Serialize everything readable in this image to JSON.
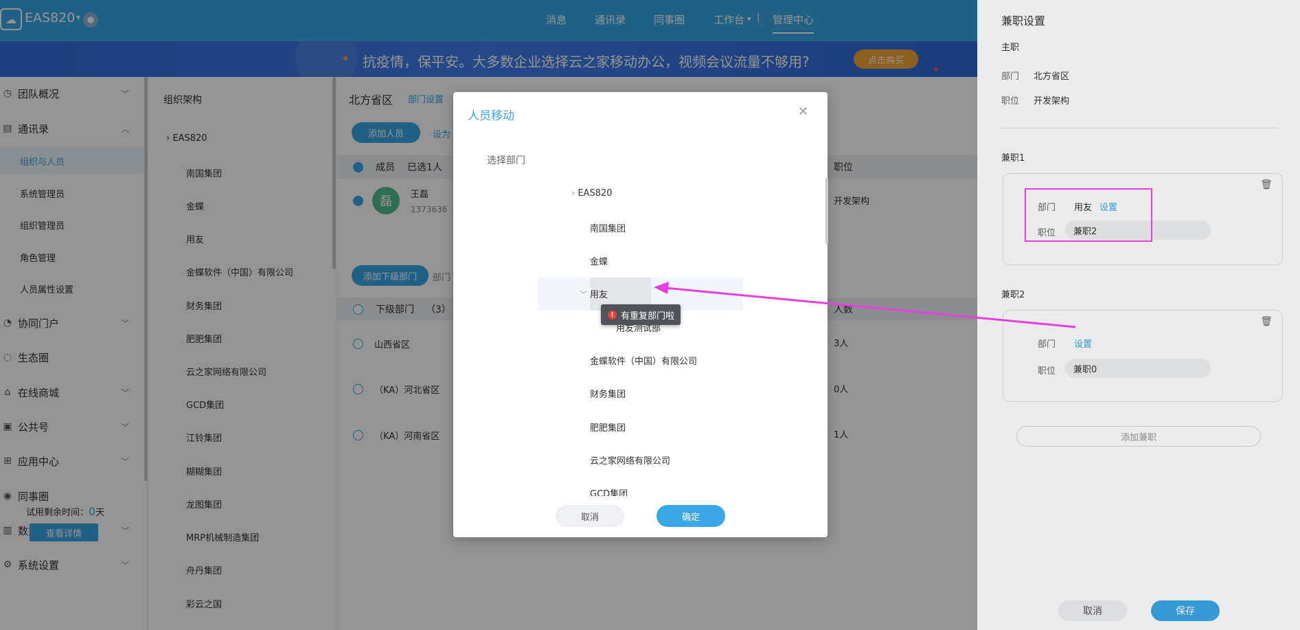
{
  "topbar": {
    "company": "EAS820",
    "nav": [
      "消息",
      "通讯录",
      "同事圈",
      "工作台",
      "管理中心"
    ]
  },
  "banner": {
    "text": "抗疫情，保平安。大多数企业选择云之家移动办公，视频会议流量不够用?",
    "button": "点击购买"
  },
  "sidebar": {
    "items": [
      {
        "label": "团队概况"
      },
      {
        "label": "通讯录"
      },
      {
        "label": "协同门户"
      },
      {
        "label": "生态圈"
      },
      {
        "label": "在线商城"
      },
      {
        "label": "公共号"
      },
      {
        "label": "应用中心"
      },
      {
        "label": "同事圈"
      },
      {
        "label": "数据运营"
      },
      {
        "label": "系统设置"
      }
    ],
    "sub_items": [
      "组织与人员",
      "系统管理员",
      "组织管理员",
      "角色管理",
      "人员属性设置"
    ],
    "trial_label": "试用剩余时间：",
    "trial_days": "0",
    "trial_unit": "天",
    "detail_button": "查看详情"
  },
  "org": {
    "title": "组织架构",
    "root": "EAS820",
    "items": [
      "南国集团",
      "金蝶",
      "用友",
      "金蝶软件（中国）有限公司",
      "财务集团",
      "肥肥集团",
      "云之家网络有限公司",
      "GCD集团",
      "江铃集团",
      "糊糊集团",
      "龙图集团",
      "MRP机械制造集团",
      "舟丹集团",
      "彩云之国"
    ]
  },
  "main": {
    "title": "北方省区",
    "dept_settings": "部门设置",
    "add_person": "添加人员",
    "set_as": "设为",
    "col_member": "成员",
    "selected": "已选1人",
    "col_position": "职位",
    "member_name": "王磊",
    "member_phone": "1373636",
    "member_avatar": "磊",
    "member_position": "开发架构",
    "add_sub_dept": "添加下级部门",
    "dept_tab": "部门",
    "sub_dept_head": "下级部门",
    "sub_dept_count": "（3）",
    "col_count": "人数",
    "sub_depts": [
      {
        "name": "山西省区",
        "count": "3人"
      },
      {
        "name": "（KA）河北省区",
        "count": "0人"
      },
      {
        "name": "（KA）河南省区",
        "count": "1人"
      }
    ]
  },
  "drawer": {
    "title": "兼职设置",
    "main_job": "主职",
    "dept_label": "部门",
    "pos_label": "职位",
    "main_dept": "北方省区",
    "main_pos": "开发架构",
    "part1_title": "兼职1",
    "part1_dept": "用友",
    "part1_pos": "兼职2",
    "set_link": "设置",
    "part2_title": "兼职2",
    "part2_pos": "兼职0",
    "add_part": "添加兼职",
    "cancel": "取消",
    "save": "保存"
  },
  "modal": {
    "title": "人员移动",
    "select_dept": "选择部门",
    "root": "EAS820",
    "items": [
      "南国集团",
      "金蝶",
      "用友",
      "用友测试部",
      "金蝶软件（中国）有限公司",
      "财务集团",
      "肥肥集团",
      "云之家网络有限公司",
      "GCD集团"
    ],
    "tooltip": "有重复部门啦",
    "cancel": "取消",
    "confirm": "确定"
  },
  "colors": {
    "primary": "#3aa8e6",
    "annotation": "#e83ee0",
    "warning": "#e8413c",
    "banner_button": "#f2a236"
  }
}
